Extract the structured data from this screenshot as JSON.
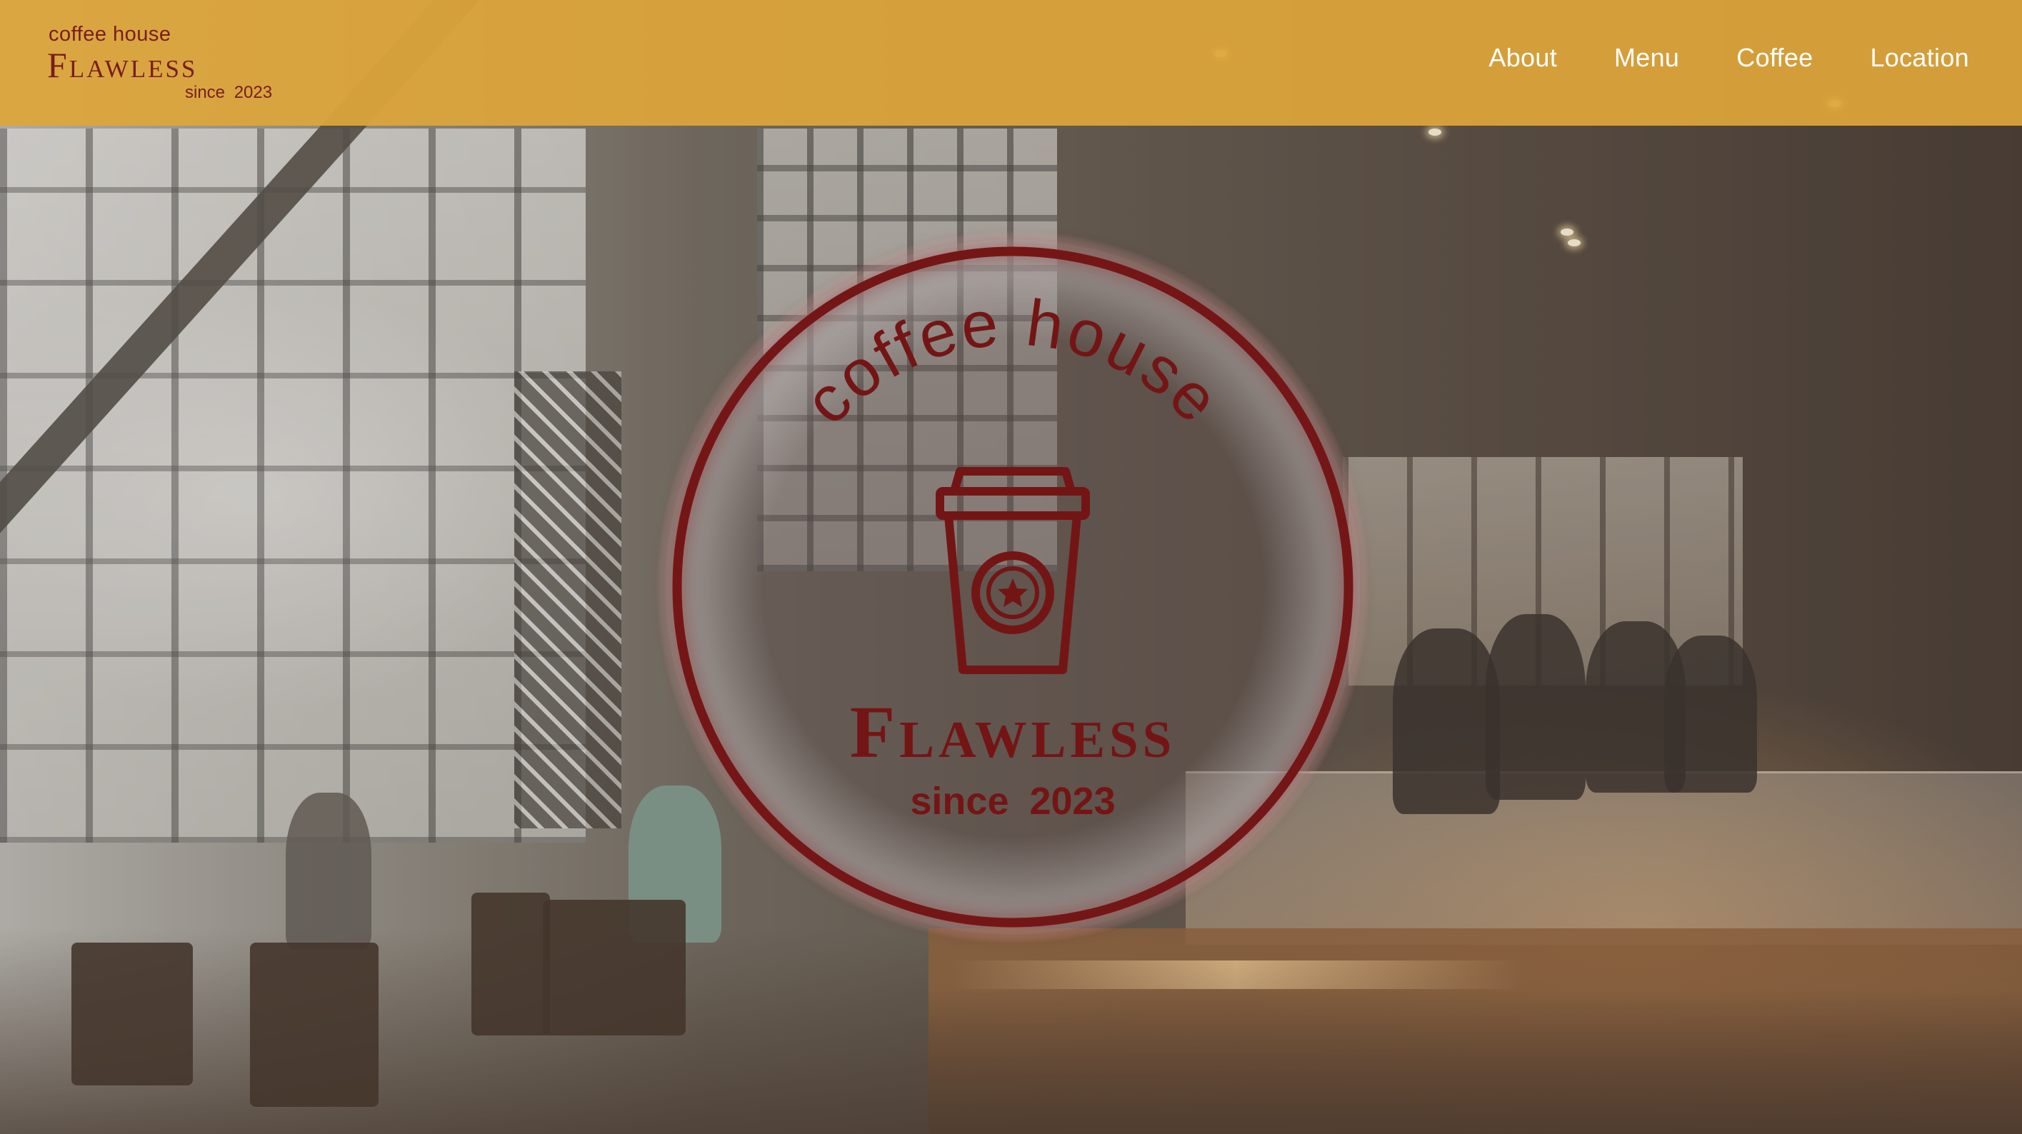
{
  "brand": {
    "tagline": "coffee house",
    "name": "Flawless",
    "since": "since 2023",
    "color": "#7a1d1d"
  },
  "nav": {
    "items": [
      {
        "label": "About"
      },
      {
        "label": "Menu"
      },
      {
        "label": "Coffee"
      },
      {
        "label": "Location"
      }
    ],
    "background": "#dea63a",
    "text_color": "#ffffff"
  },
  "hero": {
    "emblem": {
      "arc_text": "coffee house",
      "name": "Flawless",
      "since": "since 2023",
      "icon": "coffee-cup-star-icon",
      "color": "#741515"
    },
    "background_image": "coffee-shop-interior-photo"
  }
}
